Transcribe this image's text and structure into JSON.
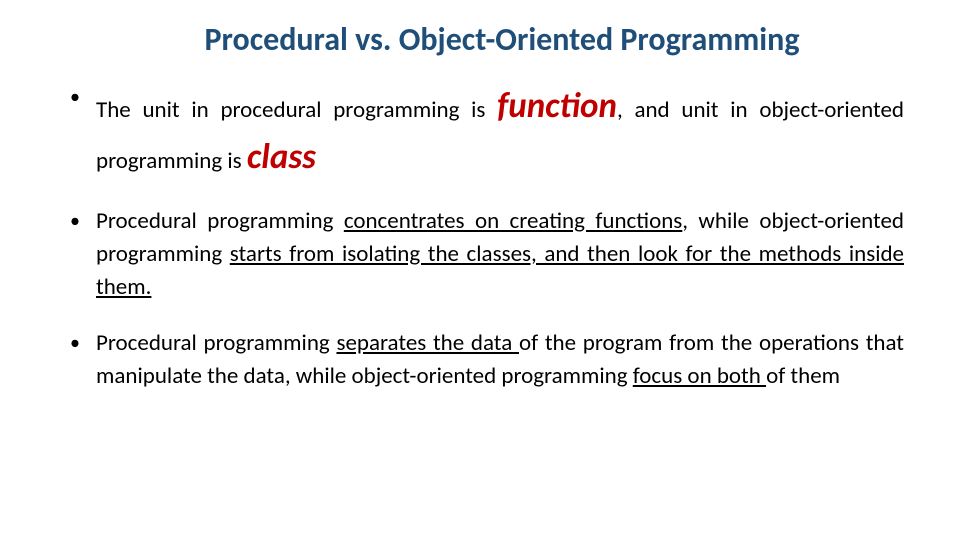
{
  "title": "Procedural vs. Object-Oriented Programming",
  "bullets": [
    {
      "pre1": "The unit in procedural programming is ",
      "em1": "function",
      "mid1": ", and unit in object-oriented programming is ",
      "em2": "class"
    },
    {
      "pre": "Procedural programming ",
      "u1": "concentrates on creating functions",
      "mid": ", while object-oriented programming ",
      "u2": "starts from isolating the classes, and then look for the methods inside them."
    },
    {
      "pre": "Procedural programming ",
      "u1": "separates the data ",
      "mid": "of the program from the operations that manipulate the data, while object-oriented programming ",
      "u2": "focus on both ",
      "post": "of them"
    }
  ]
}
